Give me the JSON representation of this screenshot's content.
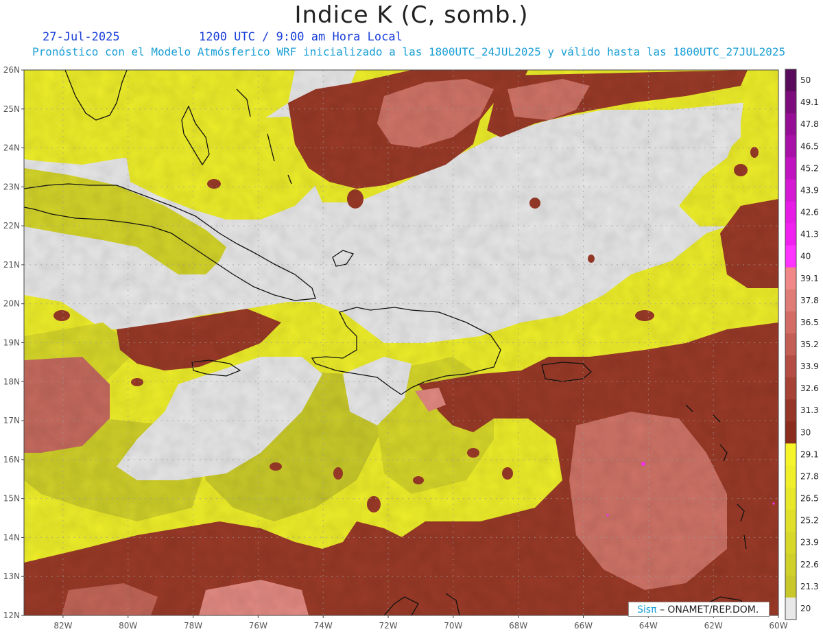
{
  "header": {
    "title": "Indice K (C, somb.)",
    "date": "27-Jul-2025",
    "time": "1200 UTC / 9:00 am Hora Local",
    "subtitle": "Pronóstico con el Modelo Atmósferico WRF inicializado a las 1800UTC_24JUL2025 y válido hasta las  1800UTC_27JUL2025"
  },
  "map": {
    "lon_range": [
      -83.2,
      -60.0
    ],
    "lat_range": [
      12.0,
      26.0
    ],
    "lat_ticks": [
      {
        "value": 26,
        "label": "26N"
      },
      {
        "value": 25,
        "label": "25N"
      },
      {
        "value": 24,
        "label": "24N"
      },
      {
        "value": 23,
        "label": "23N"
      },
      {
        "value": 22,
        "label": "22N"
      },
      {
        "value": 21,
        "label": "21N"
      },
      {
        "value": 20,
        "label": "20N"
      },
      {
        "value": 19,
        "label": "19N"
      },
      {
        "value": 18,
        "label": "18N"
      },
      {
        "value": 17,
        "label": "17N"
      },
      {
        "value": 16,
        "label": "16N"
      },
      {
        "value": 15,
        "label": "15N"
      },
      {
        "value": 14,
        "label": "14N"
      },
      {
        "value": 13,
        "label": "13N"
      },
      {
        "value": 12,
        "label": "12N"
      }
    ],
    "lon_ticks": [
      {
        "value": -82,
        "label": "82W"
      },
      {
        "value": -80,
        "label": "80W"
      },
      {
        "value": -78,
        "label": "78W"
      },
      {
        "value": -76,
        "label": "76W"
      },
      {
        "value": -74,
        "label": "74W"
      },
      {
        "value": -72,
        "label": "72W"
      },
      {
        "value": -70,
        "label": "70W"
      },
      {
        "value": -68,
        "label": "68W"
      },
      {
        "value": -66,
        "label": "66W"
      },
      {
        "value": -64,
        "label": "64W"
      },
      {
        "value": -62,
        "label": "62W"
      },
      {
        "value": -60,
        "label": "60W"
      }
    ],
    "grid": true,
    "colors": {
      "background_low": "#e8e8e8",
      "yellow_bright": "#f2f22a",
      "yellow_dim": "#d2d22a",
      "brown_dark": "#8f3322",
      "brown_mid": "#b5554a",
      "salmon": "#d9776f"
    }
  },
  "colorbar": {
    "labels": [
      "50",
      "49.1",
      "47.8",
      "46.5",
      "45.2",
      "43.9",
      "42.6",
      "41.3",
      "40",
      "39.1",
      "37.8",
      "36.5",
      "35.2",
      "33.9",
      "32.6",
      "31.3",
      "30",
      "29.1",
      "27.8",
      "26.5",
      "25.2",
      "23.9",
      "22.6",
      "21.3",
      "20"
    ],
    "colors": [
      "#5a0a5a",
      "#7c0c7c",
      "#960e96",
      "#a811a8",
      "#c014c0",
      "#d418d4",
      "#e61ce6",
      "#f020f0",
      "#ff33ff",
      "#f08888",
      "#e07c76",
      "#d26c64",
      "#c25e54",
      "#b44e44",
      "#a64236",
      "#963628",
      "#8a2c1e",
      "#f5f52a",
      "#f0f02a",
      "#e8e82a",
      "#e0e02a",
      "#d8d82a",
      "#d0d02a",
      "#c8c82a",
      "#e8e8e8"
    ]
  },
  "credit": {
    "brand": "Sisπ",
    "text": "– ONAMET/REP.DOM."
  }
}
